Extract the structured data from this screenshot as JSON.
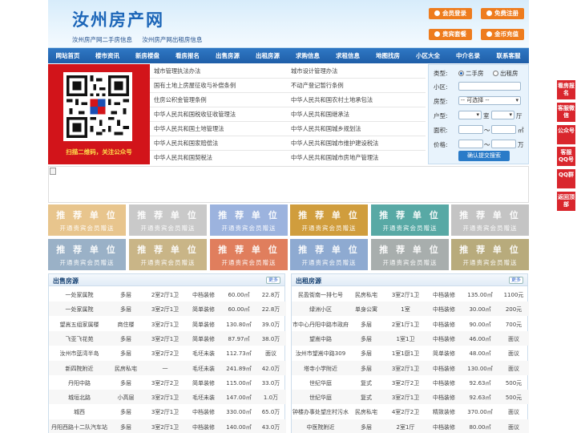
{
  "header": {
    "logo": "汝州房产网",
    "subtitle1": "汝州房产网二手房信息",
    "subtitle2": "汝州房产网出租房信息",
    "buttons": [
      "会员登录",
      "免费注册",
      "贵宾套餐",
      "金币充值"
    ]
  },
  "nav": [
    "网站首页",
    "楼市资讯",
    "新房楼盘",
    "看房报名",
    "出售房源",
    "出租房源",
    "求购信息",
    "求租信息",
    "地图找房",
    "小区大全",
    "中介名录",
    "联系客服"
  ],
  "qr": {
    "caption": "扫描二维码，关注公众号"
  },
  "laws": {
    "left": [
      "城市管理执法办法",
      "国有土地上房屋征收与补偿条例",
      "住房公积金管理条例",
      "中华人民共和国税收征收管理法",
      "中华人民共和国土地管理法",
      "中华人民共和国家赔偿法",
      "中华人民共和国契税法"
    ],
    "right": [
      "城市设计管理办法",
      "不动产登记暂行条例",
      "中华人民共和国农村土地承包法",
      "中华人民共和国继承法",
      "中华人民共和国城乡规划法",
      "中华人民共和国城市维护建设税法",
      "中华人民共和国城市房地产管理法"
    ]
  },
  "search": {
    "type_label": "类型:",
    "type_options": [
      "二手房",
      "出租房"
    ],
    "community_label": "小区:",
    "housetype_label": "房型:",
    "housetype_value": "-- 可选择 --",
    "layout_label": "户型:",
    "layout_room": "室",
    "layout_hall": "厅",
    "area_label": "面积:",
    "area_sep": "～",
    "area_unit": "㎡",
    "price_label": "价格:",
    "price_sep": "～",
    "price_unit": "万",
    "submit": "确认提交搜索"
  },
  "recommend": {
    "title": "推 荐 单 位",
    "sub": "开通贵宾会员赠送",
    "colors": [
      "#e8c58d",
      "#c9c9c9",
      "#9cb3de",
      "#d09d3d",
      "#58a9a5",
      "#c4c4c4",
      "#9ab1c7",
      "#c9b587",
      "#e07e5d",
      "#8eaad1",
      "#a8aead",
      "#b8ab7c"
    ]
  },
  "sale": {
    "title": "出售房源",
    "more": "更多",
    "rows": [
      [
        "一处家属院",
        "多层",
        "2室2厅1卫",
        "中档装修",
        "60.00㎡",
        "22.8万"
      ],
      [
        "一处家属院",
        "多层",
        "3室2厅1卫",
        "简单装修",
        "60.00㎡",
        "22.8万"
      ],
      [
        "望嵩五组家属楼",
        "商住楼",
        "3室2厅1卫",
        "简单装修",
        "130.80㎡",
        "39.0万"
      ],
      [
        "飞亚飞花苑",
        "多层",
        "3室2厅1卫",
        "简单装修",
        "87.97㎡",
        "38.0万"
      ],
      [
        "汝州市蓝湾半岛",
        "多层",
        "3室2厅2卫",
        "毛坯未装",
        "112.73㎡",
        "面议"
      ],
      [
        "新四院附近",
        "民房私宅",
        "一",
        "毛坯未装",
        "241.89㎡",
        "42.0万"
      ],
      [
        "丹阳中路",
        "多层",
        "3室2厅2卫",
        "简单装修",
        "115.00㎡",
        "33.0万"
      ],
      [
        "城垣北路",
        "小高层",
        "3室2厅1卫",
        "毛坯未装",
        "147.00㎡",
        "1.0万"
      ],
      [
        "城西",
        "多层",
        "3室2厅1卫",
        "中档装修",
        "330.00㎡",
        "65.0万"
      ],
      [
        "丹阳西路十二队汽车站",
        "多层",
        "3室2厅1卫",
        "中档装修",
        "140.00㎡",
        "43.0万"
      ]
    ]
  },
  "rent": {
    "title": "出租房源",
    "more": "更多",
    "rows": [
      [
        "民盈街南一排七号",
        "民房私宅",
        "3室2厅1卫",
        "中档装修",
        "135.00㎡",
        "1100元"
      ],
      [
        "绿洲小区",
        "单身公寓",
        "1室",
        "中档装修",
        "30.00㎡",
        "200元"
      ],
      [
        "市中心丹阳中路市政府",
        "多层",
        "2室1厅1卫",
        "中档装修",
        "90.00㎡",
        "700元"
      ],
      [
        "望嵩中路",
        "多层",
        "1室1卫",
        "中档装修",
        "46.00㎡",
        "面议"
      ],
      [
        "汝州市望嵩中路309",
        "多层",
        "1室1厨1卫",
        "简单装修",
        "48.00㎡",
        "面议"
      ],
      [
        "塔寺小学附近",
        "多层",
        "3室2厅1卫",
        "中档装修",
        "130.00㎡",
        "面议"
      ],
      [
        "世纪华庭",
        "复式",
        "3室2厅2卫",
        "中档装修",
        "92.63㎡",
        "500元"
      ],
      [
        "世纪华庭",
        "复式",
        "3室2厅1卫",
        "中档装修",
        "92.63㎡",
        "500元"
      ],
      [
        "钟楼办事处望庄村污水",
        "民房私宅",
        "4室2厅2卫",
        "精致装修",
        "370.00㎡",
        "面议"
      ],
      [
        "中医院附近",
        "多层",
        "2室1厅",
        "中档装修",
        "80.00㎡",
        "面议"
      ]
    ]
  },
  "float": [
    "看房报名",
    "客服微信",
    "公众号",
    "客服QQ号",
    "QQ群",
    "返回顶部"
  ]
}
